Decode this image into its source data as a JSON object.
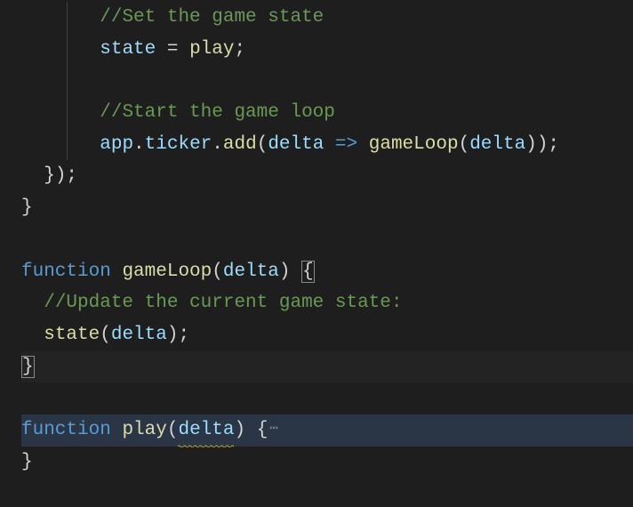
{
  "code": {
    "l1_comment": "//Set the game state",
    "l2_state": "state",
    "l2_eq": " = ",
    "l2_play": "play",
    "l2_semi": ";",
    "l4_comment": "//Start the game loop",
    "l5_app": "app",
    "l5_dot1": ".",
    "l5_ticker": "ticker",
    "l5_dot2": ".",
    "l5_add": "add",
    "l5_open": "(",
    "l5_delta1": "delta",
    "l5_arrow": " => ",
    "l5_gameLoop": "gameLoop",
    "l5_open2": "(",
    "l5_delta2": "delta",
    "l5_close2": ")",
    "l5_close": ")",
    "l5_semi": ";",
    "l6_close": "});",
    "l7_close": "}",
    "l9_function": "function",
    "l9_name": "gameLoop",
    "l9_open": "(",
    "l9_param": "delta",
    "l9_close": ") ",
    "l9_brace": "{",
    "l10_comment": "//Update the current game state:",
    "l11_state": "state",
    "l11_open": "(",
    "l11_delta": "delta",
    "l11_close": ")",
    "l11_semi": ";",
    "l12_brace": "}",
    "l14_function": "function",
    "l14_name": "play",
    "l14_open": "(",
    "l14_param": "delta",
    "l14_close": ") {",
    "l14_folded": "⋯",
    "l15_close": "}"
  }
}
